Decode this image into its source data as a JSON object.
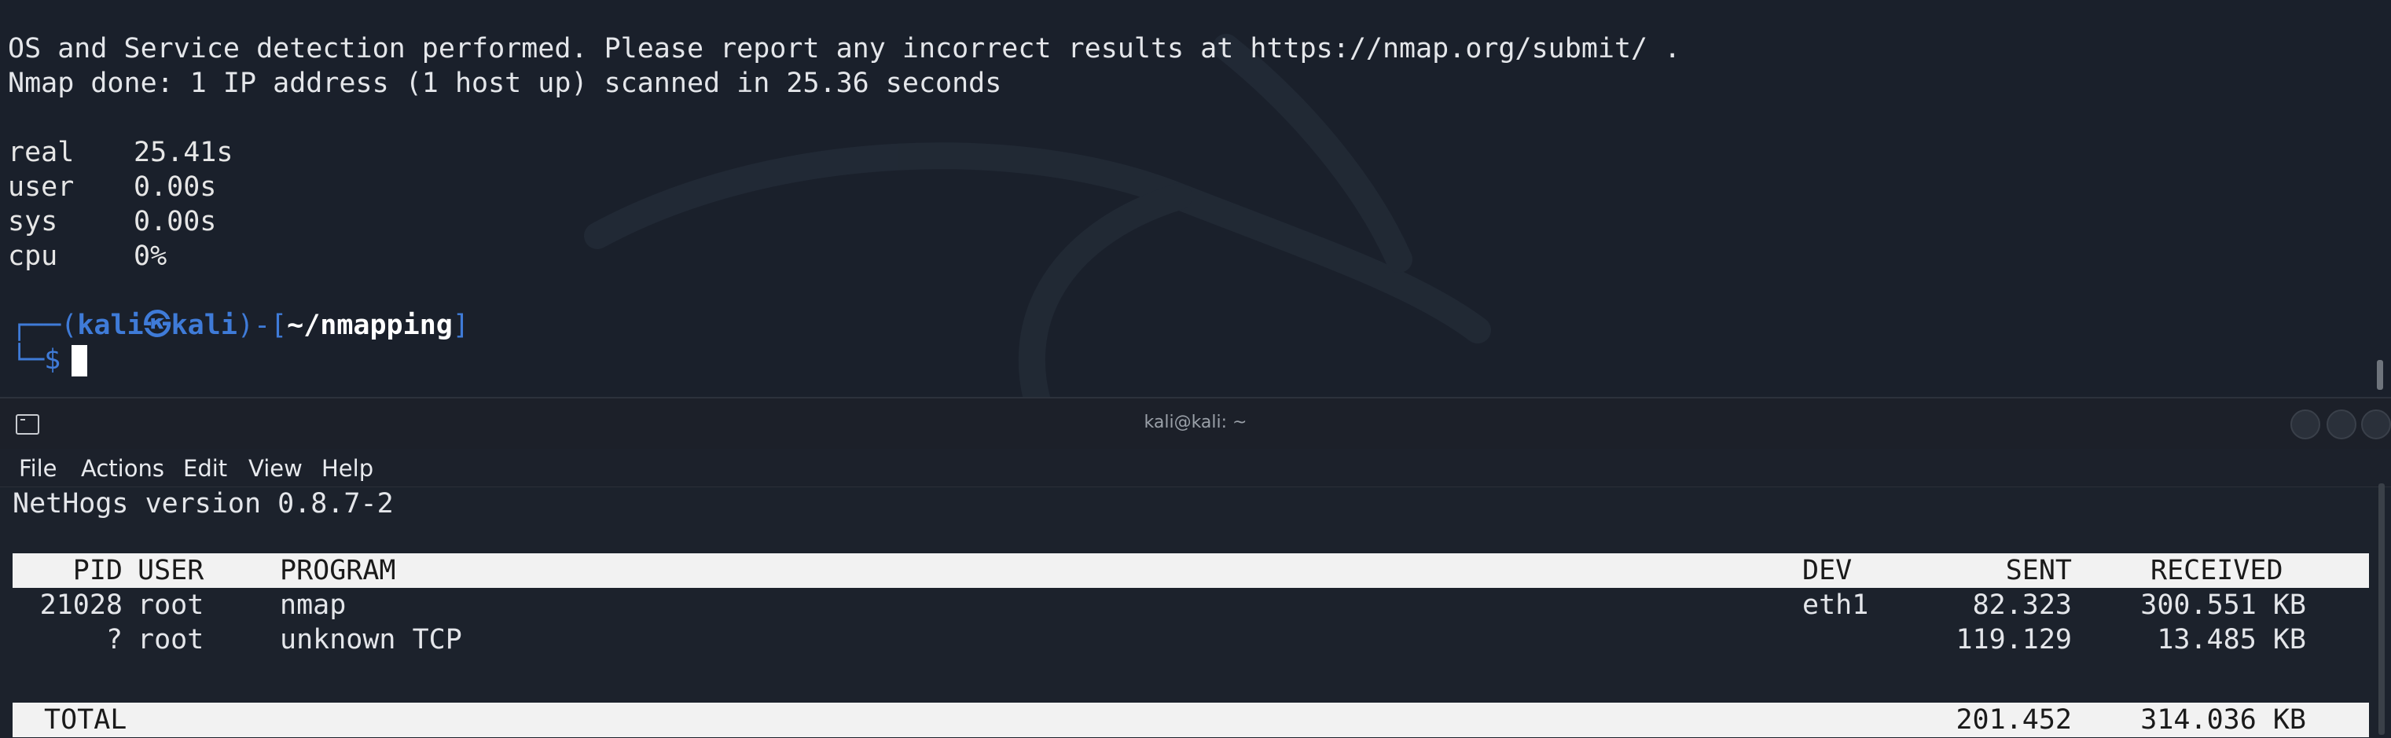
{
  "top_terminal": {
    "lines": [
      "OS and Service detection performed. Please report any incorrect results at https://nmap.org/submit/ .",
      "Nmap done: 1 IP address (1 host up) scanned in 25.36 seconds"
    ],
    "timing": [
      {
        "key": "real",
        "value": "25.41s"
      },
      {
        "key": "user",
        "value": "0.00s"
      },
      {
        "key": "sys",
        "value": "0.00s"
      },
      {
        "key": "cpu",
        "value": "0%"
      }
    ],
    "prompt": {
      "open": "┌──(",
      "user": "kali",
      "at": "㉿",
      "host": "kali",
      "mid": ")-[",
      "path": "~/nmapping",
      "close": "]",
      "line2": "└─$"
    }
  },
  "window2": {
    "title": "kali@kali: ~",
    "menu": [
      "File",
      "Actions",
      "Edit",
      "View",
      "Help"
    ],
    "version": "NetHogs version 0.8.7-2",
    "headers": {
      "pid": "PID",
      "user": "USER",
      "program": "PROGRAM",
      "dev": "DEV",
      "sent": "SENT",
      "received": "RECEIVED"
    },
    "rows": [
      {
        "pid": "21028",
        "user": "root",
        "program": "nmap",
        "dev": "eth1",
        "sent": "82.323",
        "received": "300.551 KB"
      },
      {
        "pid": "?",
        "user": "root",
        "program": "unknown TCP",
        "dev": "",
        "sent": "119.129",
        "received": "13.485 KB"
      }
    ],
    "total": {
      "label": "TOTAL",
      "sent": "201.452",
      "received": "314.036 KB"
    }
  },
  "colors": {
    "background": "#1a202b",
    "prompt_blue": "#3f7bd8",
    "header_bar": "#f2f2f2"
  }
}
